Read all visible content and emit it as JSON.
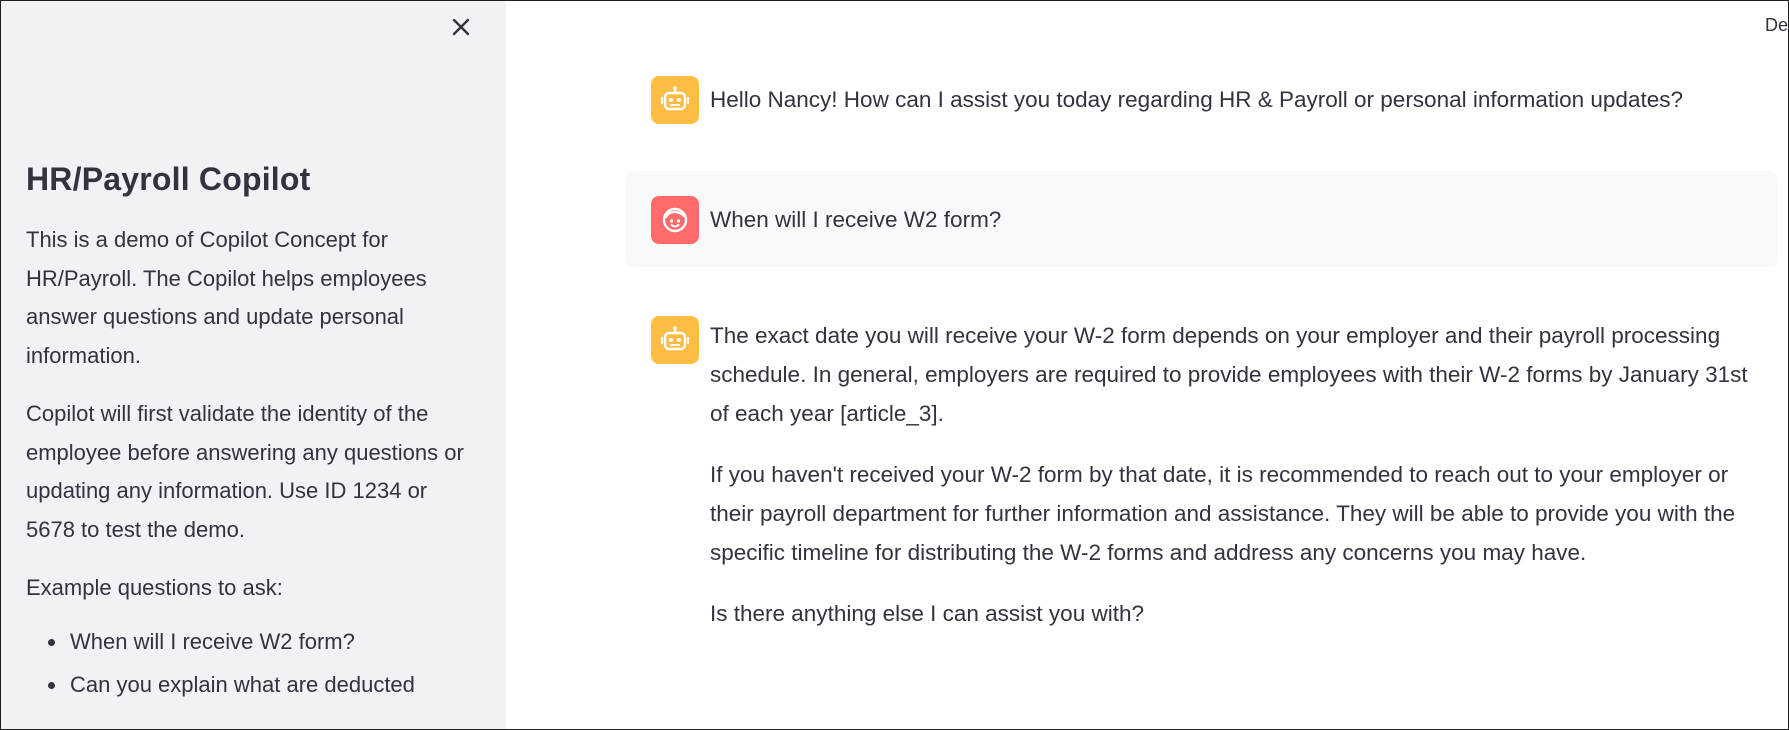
{
  "sidebar": {
    "close_icon": "close-icon",
    "title": "HR/Payroll Copilot",
    "intro": "This is a demo of Copilot Concept for HR/Payroll. The Copilot helps employees answer questions and update personal information.",
    "validation": "Copilot will first validate the identity of the employee before answering any questions or updating any information. Use ID 1234 or 5678 to test the demo.",
    "examples_heading": "Example questions to ask:",
    "examples": [
      "When will I receive W2 form?",
      "Can you explain what are deducted"
    ]
  },
  "main": {
    "corner_text": "De",
    "messages": [
      {
        "role": "assistant",
        "avatar_icon": "robot-icon",
        "paragraphs": [
          "Hello Nancy! How can I assist you today regarding HR & Payroll or personal information updates?"
        ]
      },
      {
        "role": "user",
        "avatar_icon": "user-face-icon",
        "paragraphs": [
          "When will I receive W2 form?"
        ]
      },
      {
        "role": "assistant",
        "avatar_icon": "robot-icon",
        "paragraphs": [
          "The exact date you will receive your W-2 form depends on your employer and their payroll processing schedule. In general, employers are required to provide employees with their W-2 forms by January 31st of each year [article_3].",
          "If you haven't received your W-2 form by that date, it is recommended to reach out to your employer or their payroll department for further information and assistance. They will be able to provide you with the specific timeline for distributing the W-2 forms and address any concerns you may have.",
          "Is there anything else I can assist you with?"
        ]
      }
    ]
  },
  "colors": {
    "sidebar_bg": "#f0f2f6",
    "bot_avatar": "#ffbd45",
    "user_avatar": "#ff6b6b",
    "user_bubble_bg": "#f8f9fb",
    "text": "#31333f"
  }
}
